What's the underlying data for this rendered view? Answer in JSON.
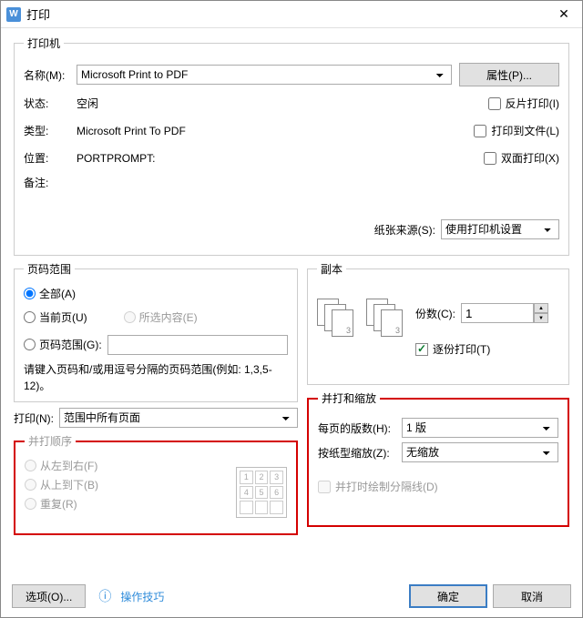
{
  "titlebar": {
    "icon_letter": "W",
    "title": "打印"
  },
  "printer": {
    "legend": "打印机",
    "name_label": "名称(M):",
    "name_value": "Microsoft Print to PDF",
    "properties_btn": "属性(P)...",
    "status_label": "状态:",
    "status_value": "空闲",
    "type_label": "类型:",
    "type_value": "Microsoft Print To PDF",
    "where_label": "位置:",
    "where_value": "PORTPROMPT:",
    "comment_label": "备注:",
    "mirror": "反片打印(I)",
    "to_file": "打印到文件(L)",
    "duplex": "双面打印(X)",
    "paper_source_label": "纸张来源(S):",
    "paper_source_value": "使用打印机设置"
  },
  "page_range": {
    "legend": "页码范围",
    "all": "全部(A)",
    "current": "当前页(U)",
    "selection": "所选内容(E)",
    "range": "页码范围(G):",
    "hint": "请键入页码和/或用逗号分隔的页码范围(例如: 1,3,5-12)。"
  },
  "copies": {
    "legend": "副本",
    "count_label": "份数(C):",
    "count_value": "1",
    "collate": "逐份打印(T)"
  },
  "print_what": {
    "label": "打印(N):",
    "value": "范围中所有页面"
  },
  "order": {
    "legend": "并打顺序",
    "lr": "从左到右(F)",
    "tb": "从上到下(B)",
    "repeat": "重复(R)"
  },
  "scale": {
    "legend": "并打和缩放",
    "pages_per_sheet_label": "每页的版数(H):",
    "pages_per_sheet_value": "1 版",
    "scale_to_paper_label": "按纸型缩放(Z):",
    "scale_to_paper_value": "无缩放",
    "draw_lines": "并打时绘制分隔线(D)"
  },
  "footer": {
    "options": "选项(O)...",
    "tip": "操作技巧",
    "ok": "确定",
    "cancel": "取消"
  }
}
